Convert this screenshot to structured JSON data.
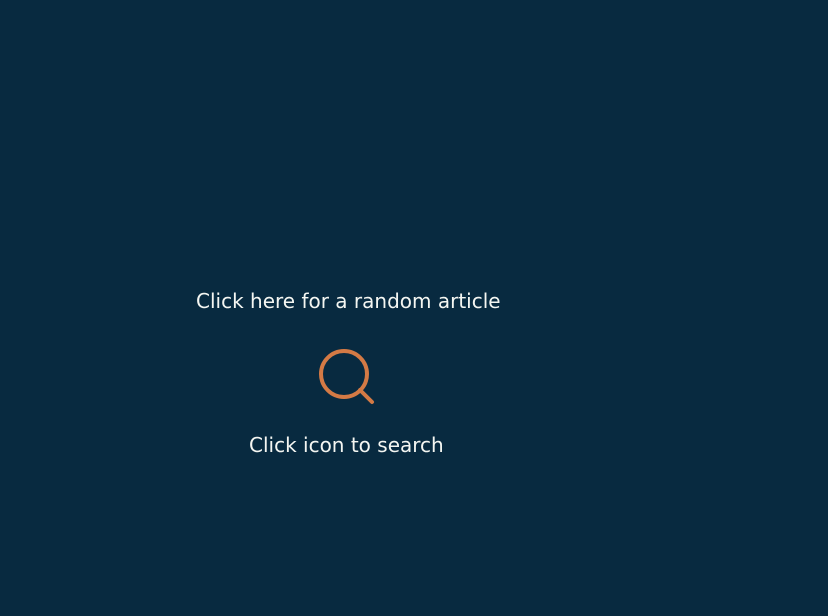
{
  "random_article": {
    "label": "Click here for a random article"
  },
  "search": {
    "icon": "search-icon",
    "icon_color": "#d47a45",
    "hint": "Click icon to search"
  },
  "colors": {
    "background": "#082a40",
    "text": "#f4f6f2"
  }
}
